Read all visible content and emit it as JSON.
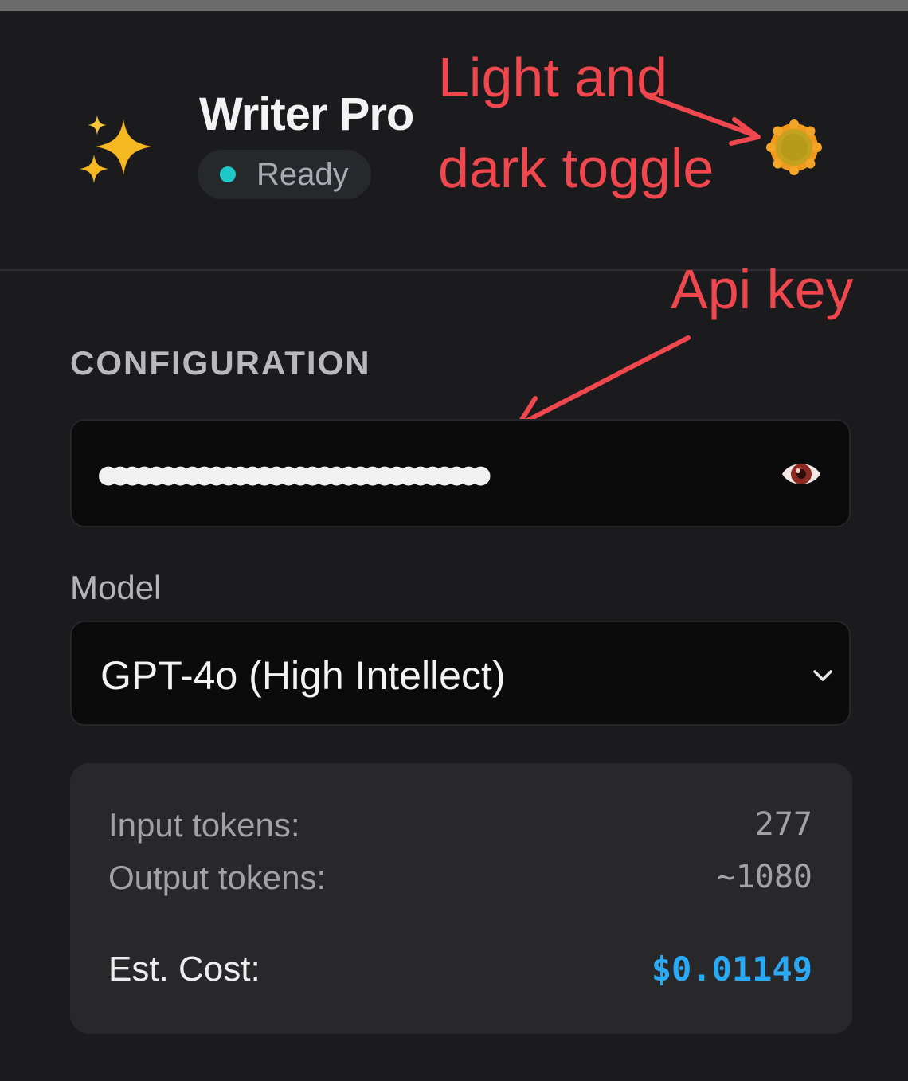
{
  "app": {
    "title": "Writer Pro",
    "status": "Ready",
    "logo_icon": "sparkles-icon",
    "theme_toggle_icon": "sun-icon"
  },
  "annotations": {
    "toggle_line1": "Light and",
    "toggle_line2": "dark toggle",
    "api_key": "Api key"
  },
  "configuration": {
    "section_title": "CONFIGURATION",
    "api_key_masked": "●●●●●●●●●●●●●●●●●●●●●●●●●●●●●●●●",
    "api_key_toggle_icon": "eye-icon",
    "model_label": "Model",
    "model_selected": "GPT-4o (High Intellect)"
  },
  "stats": {
    "input_label": "Input tokens:",
    "input_value": "277",
    "output_label": "Output tokens:",
    "output_value": "~1080",
    "cost_label": "Est. Cost:",
    "cost_value": "$0.01149"
  },
  "colors": {
    "background": "#1b1b1e",
    "accent_cost": "#2aa9f5",
    "status_dot": "#1ec8c8",
    "annotation_red": "#f0464d"
  }
}
